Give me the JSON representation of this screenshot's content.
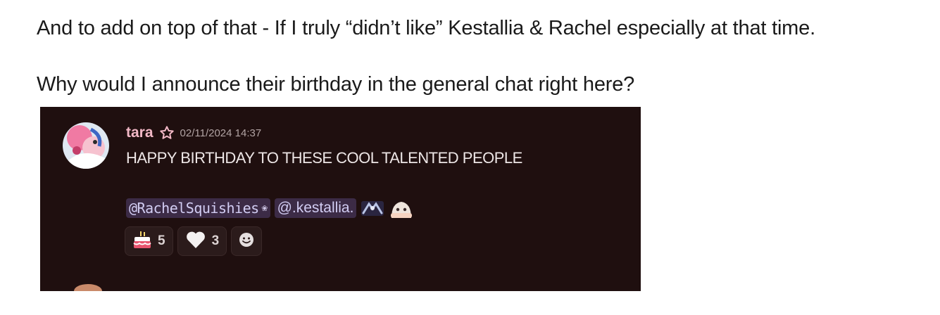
{
  "post": {
    "line1": "And to add on top of that - If I truly “didn’t like” Kestallia & Rachel especially at that time.",
    "line2": "Why would I announce their birthday in the general chat right here?"
  },
  "message": {
    "username": "tara",
    "role_icon": "star-outline-icon",
    "timestamp": "02/11/2024 14:37",
    "text": "HAPPY BIRTHDAY TO THESE COOL TALENTED PEOPLE",
    "mentions": [
      {
        "label": "@RachelSquishies",
        "suffix_icon": "flower-icon"
      },
      {
        "label": "@.kestallia.",
        "suffix_icons": [
          "handshake-emoji",
          "peeking-emoji"
        ]
      }
    ],
    "reactions": [
      {
        "icon": "birthday-cake-icon",
        "count": "5"
      },
      {
        "icon": "white-heart-icon",
        "count": "3"
      },
      {
        "icon": "add-reaction-icon"
      }
    ]
  },
  "colors": {
    "chat_background": "#1f0f0f",
    "username": "#f2b8c6",
    "mention_background": "#3c2b46",
    "mention_text": "#d2cdf3",
    "message_text": "#ede6e6"
  }
}
